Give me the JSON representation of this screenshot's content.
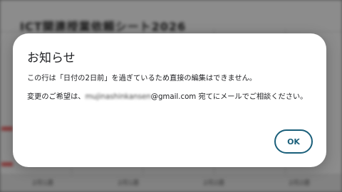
{
  "background": {
    "sheet_title": "ICT関連授業依頼シート2026",
    "footer_cells": [
      "2月1週",
      "2月1週",
      "2月2週",
      "2月2週"
    ]
  },
  "dialog": {
    "title": "お知らせ",
    "message_1": "この行は「日付の2日前」を過ぎているため直接の編集はできません。",
    "message_2_prefix": "変更のご希望は、",
    "email_hidden": "mujinashinkansen",
    "email_domain": "@gmail.com",
    "message_2_suffix": " 宛てにメールでご相談ください。",
    "ok_label": "OK"
  },
  "colors": {
    "accent": "#1a5f7a",
    "dialog_bg": "#ffffff",
    "overlay": "#000000"
  }
}
